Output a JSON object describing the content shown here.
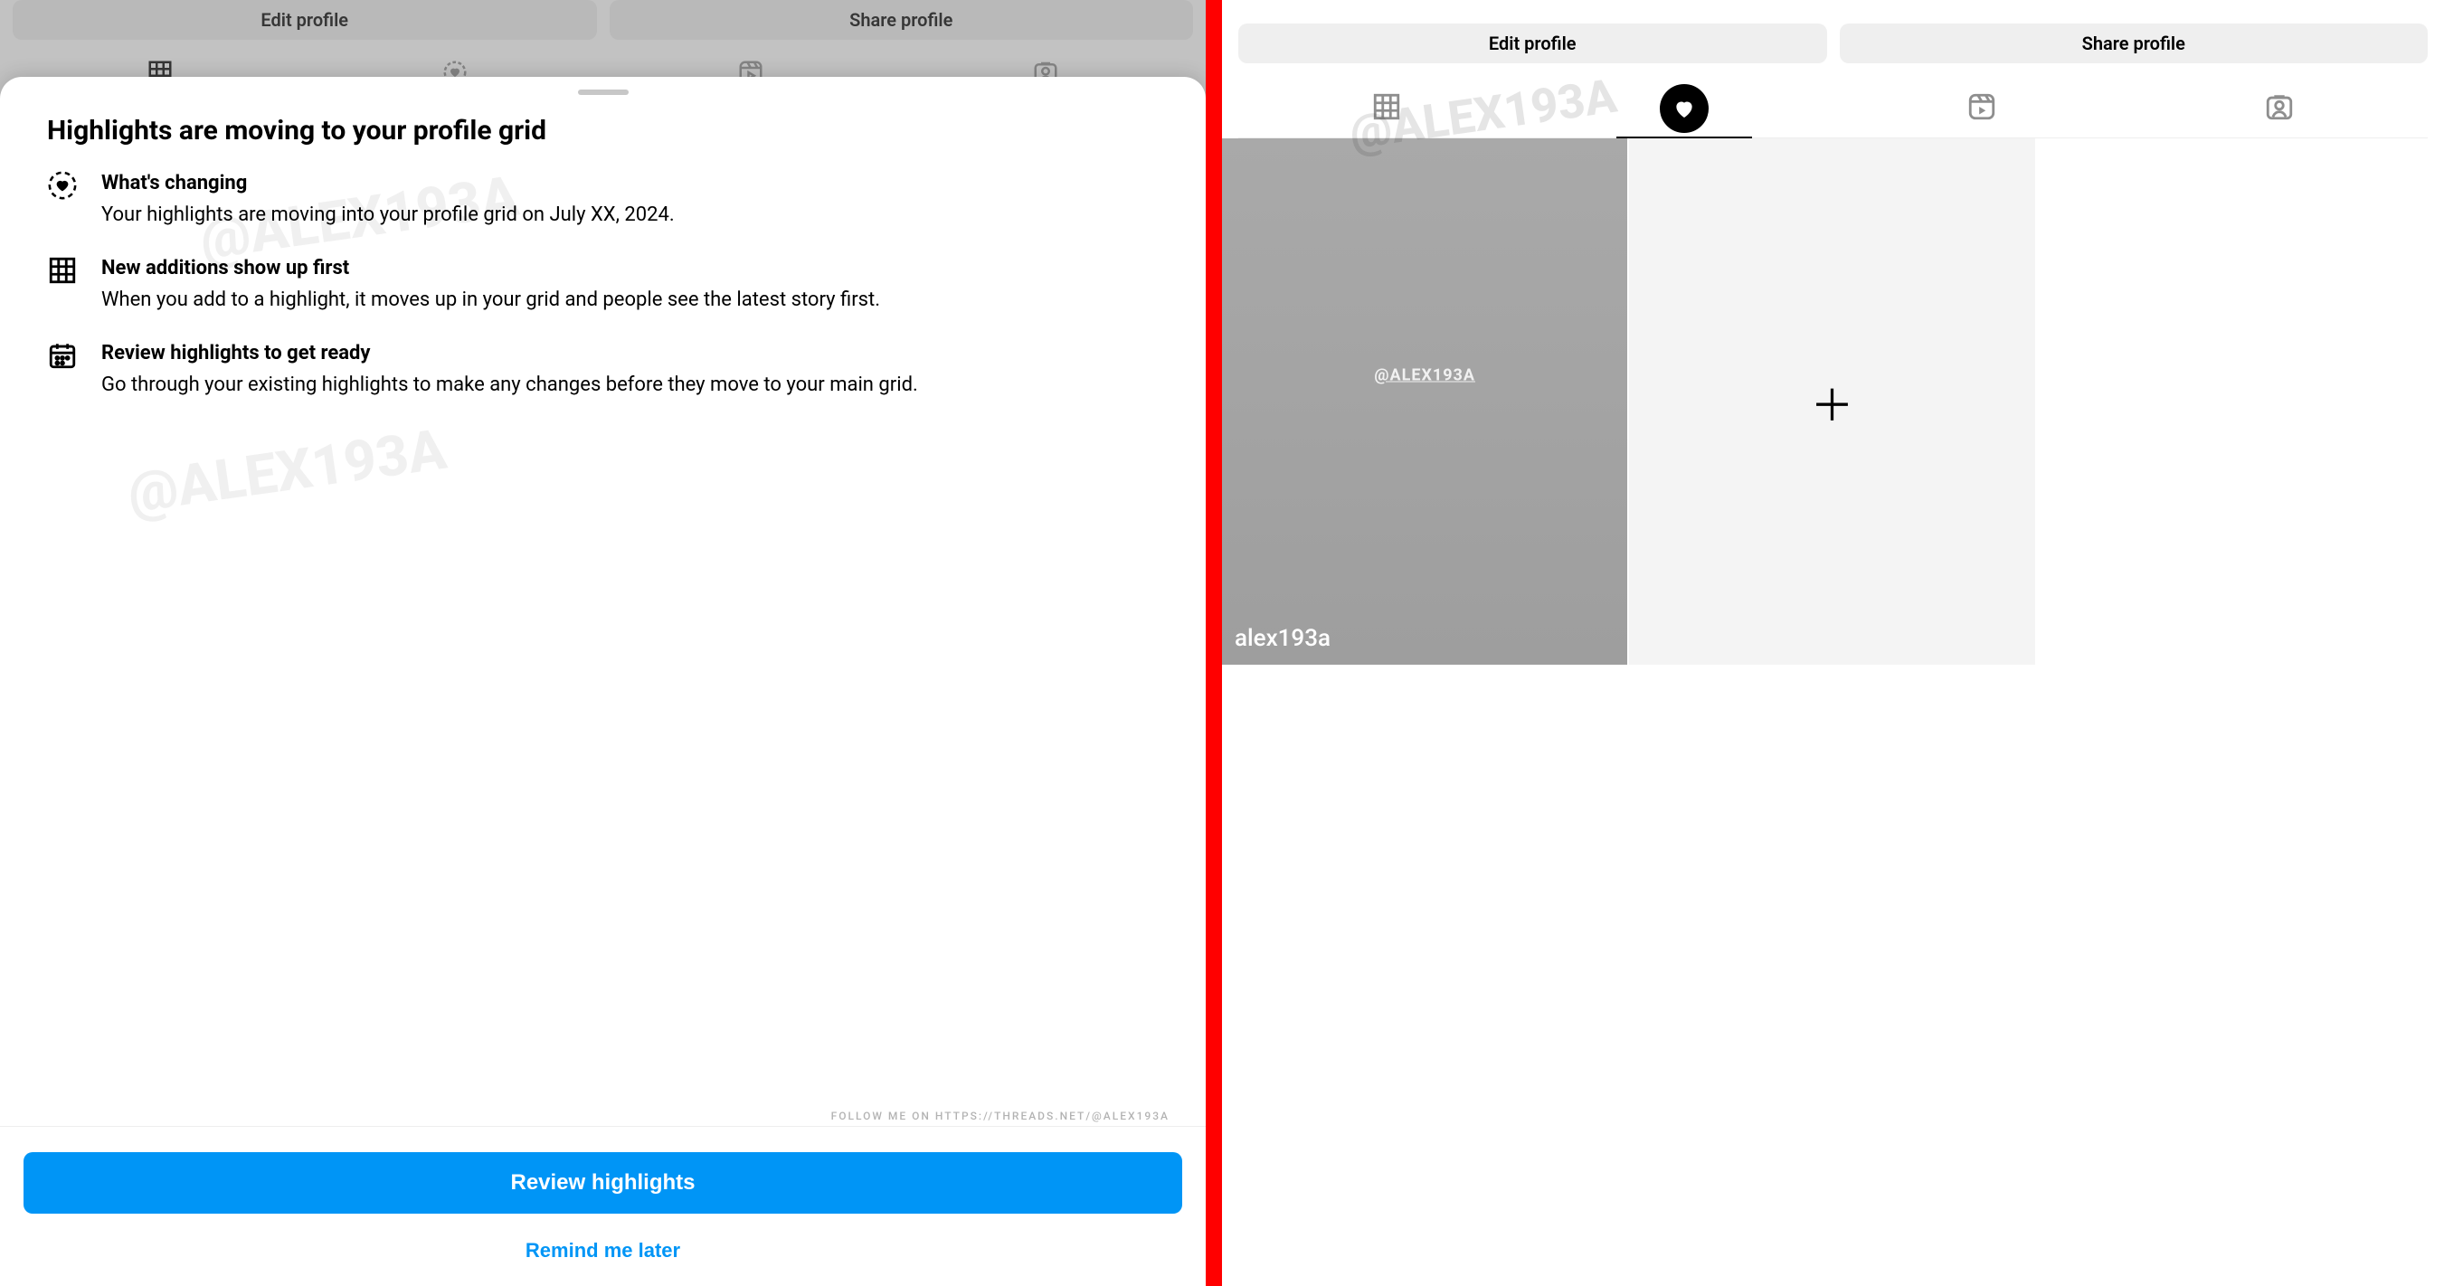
{
  "left": {
    "backdrop": {
      "edit_btn": "Edit profile",
      "share_btn": "Share profile"
    },
    "sheet": {
      "title": "Highlights are moving to your profile grid",
      "items": [
        {
          "title": "What's changing",
          "body": "Your highlights are moving into your profile grid on July XX, 2024."
        },
        {
          "title": "New additions show up first",
          "body": "When you add to a highlight, it moves up in your grid and people see the latest story first."
        },
        {
          "title": "Review highlights to get ready",
          "body": "Go through your existing highlights to make any changes before they move to your main grid."
        }
      ],
      "follow_line": "FOLLOW ME ON HTTPS://THREADS.NET/@ALEX193A",
      "primary": "Review highlights",
      "secondary": "Remind me later",
      "watermark": "@ALEX193A"
    }
  },
  "right": {
    "edit_btn": "Edit profile",
    "share_btn": "Share profile",
    "watermark": "@ALEX193A",
    "highlight_tile": {
      "label": "alex193a",
      "watermark": "@ALEX193A"
    }
  }
}
